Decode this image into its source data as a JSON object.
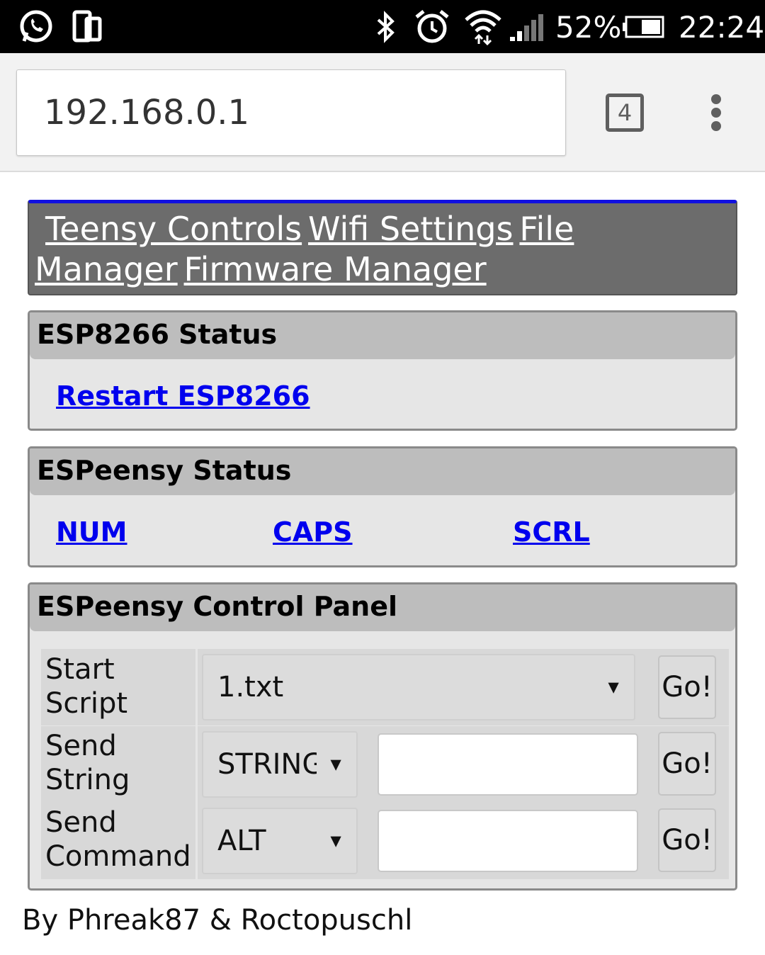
{
  "status_bar": {
    "battery": "52%",
    "time": "22:24",
    "icons": [
      "whatsapp-icon",
      "screen-mirror-icon",
      "bluetooth-icon",
      "alarm-icon",
      "wifi-icon",
      "signal-icon",
      "battery-icon"
    ]
  },
  "browser": {
    "url": "192.168.0.1",
    "tab_count": "4"
  },
  "nav": {
    "items": [
      "Teensy Controls",
      "Wifi Settings",
      "File",
      "Manager",
      "Firmware Manager"
    ]
  },
  "esp_status": {
    "title": "ESP8266 Status",
    "restart_link": "Restart ESP8266"
  },
  "espeensy_status": {
    "title": "ESPeensy Status",
    "num": "NUM",
    "caps": "CAPS",
    "scrl": "SCRL"
  },
  "control_panel": {
    "title": "ESPeensy Control Panel",
    "rows": [
      {
        "label_line1": "Start",
        "label_line2": "Script",
        "select": "1.txt",
        "button": "Go!"
      },
      {
        "label_line1": "Send",
        "label_line2": "String",
        "select": "STRING",
        "input_value": "",
        "button": "Go!"
      },
      {
        "label_line1": "Send",
        "label_line2": "Command",
        "select": "ALT",
        "input_value": "",
        "button": "Go!"
      }
    ]
  },
  "footer": "By Phreak87 & Roctopuschl",
  "colors": {
    "nav_bg": "#6c6c6c",
    "nav_accent": "#1010e0",
    "panel_bg": "#e6e6e6",
    "panel_head": "#bdbdbd",
    "link": "#0000ee"
  }
}
